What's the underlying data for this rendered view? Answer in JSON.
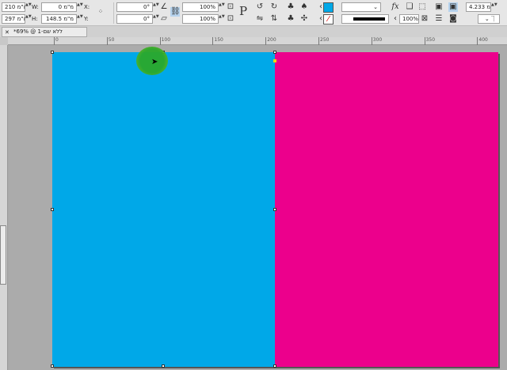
{
  "control_panel": {
    "w_label": "W:",
    "w_value": "210 מ\"מ",
    "h_label": "H:",
    "h_value": "297 מ\"מ",
    "x_label": "X:",
    "x_value": "0 מ\"מ",
    "y_label": "Y:",
    "y_value": "148.5 מ\"מ",
    "rotate_value": "0°",
    "shear_value": "0°",
    "scale_x": "100%",
    "scale_y": "100%",
    "opacity": "100%",
    "stroke_weight": "4.233 מ\"מ",
    "fill_color": "#00a8e8"
  },
  "document_tab": {
    "title": "ללא שם-1 @ 69%*",
    "close": "✕"
  },
  "ruler": {
    "labels": [
      "0",
      "50",
      "100",
      "150",
      "200",
      "250",
      "300",
      "350",
      "400"
    ]
  },
  "page": {
    "left_color": "#00a8e8",
    "right_color": "#ec008c"
  }
}
